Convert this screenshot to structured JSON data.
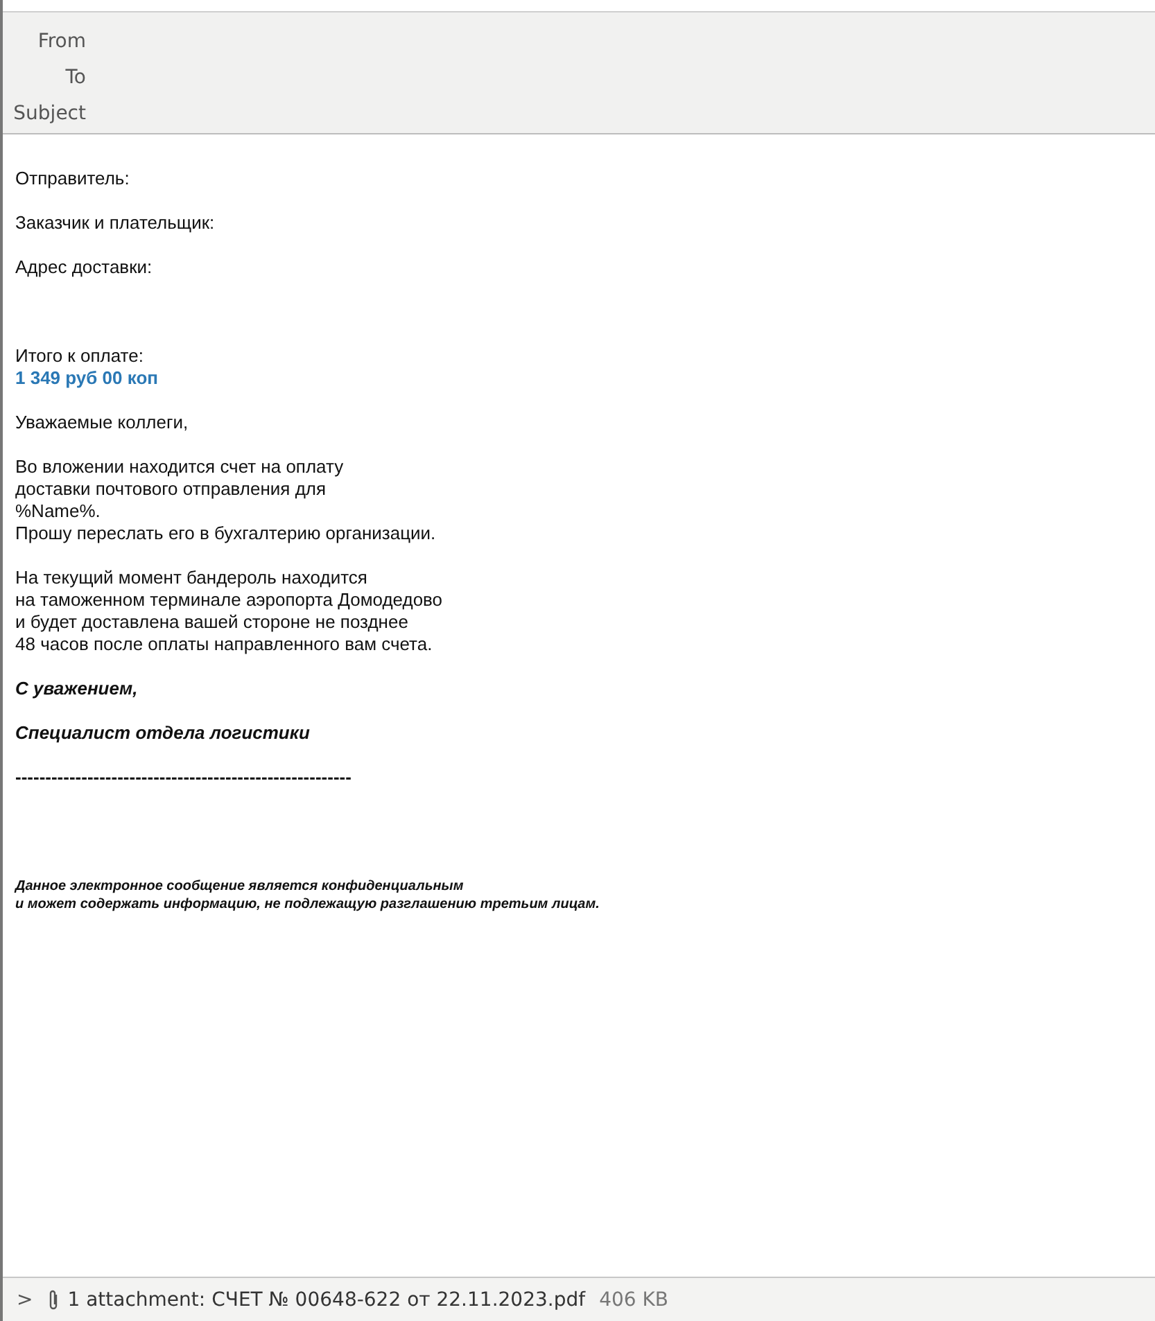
{
  "header": {
    "fields": [
      {
        "label": "From"
      },
      {
        "label": "To"
      },
      {
        "label": "Subject"
      }
    ]
  },
  "body": [
    {
      "kind": "plain",
      "lines": [
        "Отправитель:"
      ]
    },
    {
      "kind": "plain",
      "lines": [
        "Заказчик и плательщик:"
      ]
    },
    {
      "kind": "plain",
      "lines": [
        "Адрес доставки:"
      ]
    },
    {
      "kind": "plain",
      "lines": [
        "Итого к оплате:"
      ]
    },
    {
      "kind": "amount",
      "lines": [
        "1 349 руб 00 коп"
      ]
    },
    {
      "kind": "plain",
      "lines": [
        "Уважаемые коллеги,"
      ]
    },
    {
      "kind": "plain",
      "lines": [
        "Во вложении находится счет на оплату",
        "доставки почтового отправления для",
        "%Name%.",
        "Прошу переслать его в бухгалтерию организации."
      ]
    },
    {
      "kind": "plain",
      "lines": [
        "На текущий момент бандероль находится",
        "на таможенном терминале аэропорта Домодедово",
        "и будет доставлена вашей стороне не позднее",
        "48 часов после оплаты направленного вам счета."
      ]
    },
    {
      "kind": "signature",
      "lines": [
        "С уважением,"
      ]
    },
    {
      "kind": "signature",
      "lines": [
        "Специалист отдела логистики"
      ]
    },
    {
      "kind": "separator",
      "lines": [
        "--------------------------------------------------------"
      ]
    },
    {
      "kind": "disclaimer",
      "lines": [
        "Данное электронное сообщение является конфиденциальным",
        "и может содержать информацию, не подлежащую разглашению третьим лицам."
      ]
    }
  ],
  "attachments": {
    "expand": ">",
    "summary": "1 attachment: СЧЕТ № 00648-622 от 22.11.2023.pdf",
    "size": "406 KB"
  }
}
